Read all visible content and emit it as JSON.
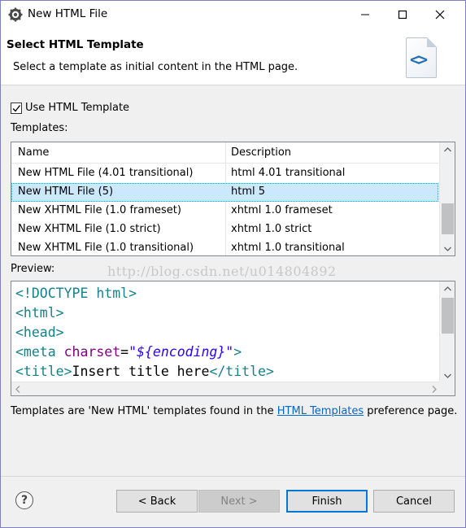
{
  "window": {
    "title": "New HTML File",
    "controls": {
      "minimize": "minimize-icon",
      "maximize": "maximize-icon",
      "close": "close-icon"
    }
  },
  "header": {
    "title": "Select HTML Template",
    "description": "Select a template as initial content in the HTML page."
  },
  "use_template": {
    "label": "Use HTML Template",
    "checked": true
  },
  "templates": {
    "label": "Templates:",
    "columns": [
      "Name",
      "Description"
    ],
    "rows": [
      {
        "name": "New HTML File (4.01 transitional)",
        "description": "html 4.01 transitional",
        "selected": false
      },
      {
        "name": "New HTML File (5)",
        "description": "html 5",
        "selected": true
      },
      {
        "name": "New XHTML File (1.0 frameset)",
        "description": "xhtml 1.0 frameset",
        "selected": false
      },
      {
        "name": "New XHTML File (1.0 strict)",
        "description": "xhtml 1.0 strict",
        "selected": false
      },
      {
        "name": "New XHTML File (1.0 transitional)",
        "description": "xhtml 1.0 transitional",
        "selected": false
      }
    ]
  },
  "preview": {
    "label": "Preview:",
    "lines": [
      {
        "tag_open": "<!DOCTYPE ",
        "kw": "html",
        "tag_close": ">"
      },
      {
        "text": "<html>"
      },
      {
        "text": "<head>"
      },
      {
        "meta_tag": "<meta ",
        "attr": "charset",
        "eq": "=",
        "str": "\"${encoding}\"",
        "end": ">"
      },
      {
        "title_open": "<title>",
        "title_text": "Insert title here",
        "title_close": "</title>"
      }
    ]
  },
  "watermark": "http://blog.csdn.net/u014804892",
  "footer_note": {
    "before": "Templates are 'New HTML' templates found in the ",
    "link": "HTML Templates",
    "after": " preference page."
  },
  "buttons": {
    "help": "?",
    "back": "< Back",
    "next": "Next >",
    "finish": "Finish",
    "cancel": "Cancel"
  }
}
